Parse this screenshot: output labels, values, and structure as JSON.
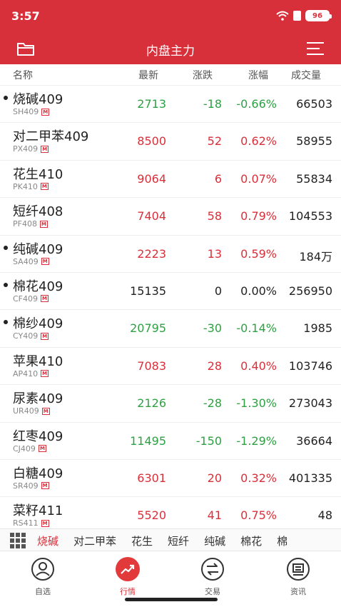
{
  "status_bar": {
    "time": "3:57",
    "battery": "96"
  },
  "nav": {
    "title": "内盘主力"
  },
  "columns": {
    "name": "名称",
    "last": "最新",
    "change": "涨跌",
    "pct": "涨幅",
    "volume": "成交量"
  },
  "rows": [
    {
      "name": "烧碱409",
      "code": "SH409",
      "tag": "M",
      "last": "2713",
      "change": "-18",
      "pct": "-0.66%",
      "volume": "66503",
      "trend": "down",
      "dot": true
    },
    {
      "name": "对二甲苯409",
      "code": "PX409",
      "tag": "M",
      "last": "8500",
      "change": "52",
      "pct": "0.62%",
      "volume": "58955",
      "trend": "up",
      "dot": false
    },
    {
      "name": "花生410",
      "code": "PK410",
      "tag": "M",
      "last": "9064",
      "change": "6",
      "pct": "0.07%",
      "volume": "55834",
      "trend": "up",
      "dot": false
    },
    {
      "name": "短纤408",
      "code": "PF408",
      "tag": "M",
      "last": "7404",
      "change": "58",
      "pct": "0.79%",
      "volume": "104553",
      "trend": "up",
      "dot": false
    },
    {
      "name": "纯碱409",
      "code": "SA409",
      "tag": "M",
      "last": "2223",
      "change": "13",
      "pct": "0.59%",
      "volume": "184万",
      "trend": "up",
      "dot": true
    },
    {
      "name": "棉花409",
      "code": "CF409",
      "tag": "M",
      "last": "15135",
      "change": "0",
      "pct": "0.00%",
      "volume": "256950",
      "trend": "flat",
      "dot": true
    },
    {
      "name": "棉纱409",
      "code": "CY409",
      "tag": "M",
      "last": "20795",
      "change": "-30",
      "pct": "-0.14%",
      "volume": "1985",
      "trend": "down",
      "dot": true
    },
    {
      "name": "苹果410",
      "code": "AP410",
      "tag": "M",
      "last": "7083",
      "change": "28",
      "pct": "0.40%",
      "volume": "103746",
      "trend": "up",
      "dot": false
    },
    {
      "name": "尿素409",
      "code": "UR409",
      "tag": "M",
      "last": "2126",
      "change": "-28",
      "pct": "-1.30%",
      "volume": "273043",
      "trend": "down",
      "dot": false
    },
    {
      "name": "红枣409",
      "code": "CJ409",
      "tag": "M",
      "last": "11495",
      "change": "-150",
      "pct": "-1.29%",
      "volume": "36664",
      "trend": "down",
      "dot": false
    },
    {
      "name": "白糖409",
      "code": "SR409",
      "tag": "M",
      "last": "6301",
      "change": "20",
      "pct": "0.32%",
      "volume": "401335",
      "trend": "up",
      "dot": false
    },
    {
      "name": "菜籽411",
      "code": "RS411",
      "tag": "M",
      "last": "5520",
      "change": "41",
      "pct": "0.75%",
      "volume": "48",
      "trend": "up",
      "dot": false
    }
  ],
  "quick_nav": {
    "items": [
      "烧碱",
      "对二甲苯",
      "花生",
      "短纤",
      "纯碱",
      "棉花",
      "棉"
    ],
    "active_index": 0
  },
  "tabs": [
    {
      "label": "自选",
      "icon": "person-icon"
    },
    {
      "label": "行情",
      "icon": "trend-icon",
      "active": true
    },
    {
      "label": "交易",
      "icon": "trade-icon"
    },
    {
      "label": "资讯",
      "icon": "news-icon"
    }
  ],
  "colors": {
    "brand": "#d8303a",
    "up": "#d8303a",
    "down": "#2ea043"
  }
}
